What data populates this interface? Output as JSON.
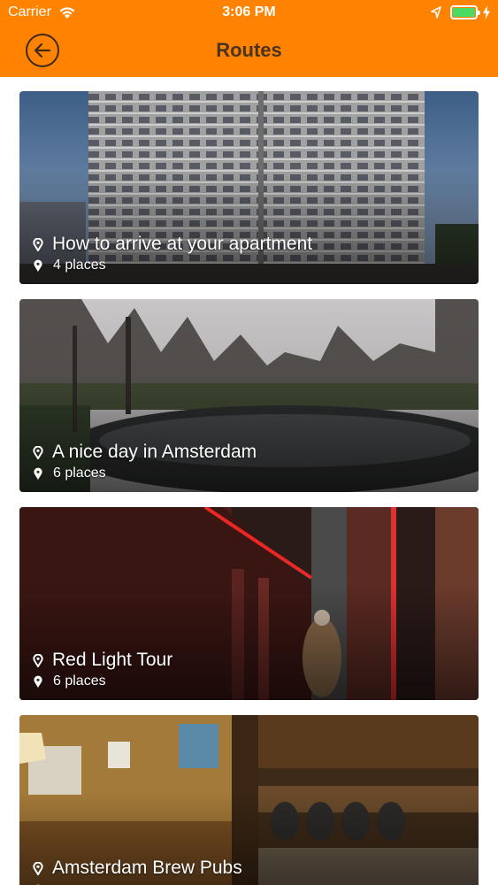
{
  "status_bar": {
    "carrier": "Carrier",
    "time": "3:06 PM",
    "battery_level": 1.0
  },
  "header": {
    "title": "Routes",
    "back_icon": "back-arrow-circle-icon",
    "background_color": "#ff8300"
  },
  "routes": [
    {
      "title": "How to arrive at your apartment",
      "places": "4 places",
      "image": "apartment-building"
    },
    {
      "title": "A nice day in Amsterdam",
      "places": "6 places",
      "image": "park-pond"
    },
    {
      "title": "Red Light Tour",
      "places": "6 places",
      "image": "red-light-alley"
    },
    {
      "title": "Amsterdam Brew Pubs",
      "places": "",
      "image": "pub-interior"
    }
  ],
  "colors": {
    "accent": "#ff8300",
    "header_text": "#4a3320",
    "battery": "#4cd964"
  }
}
